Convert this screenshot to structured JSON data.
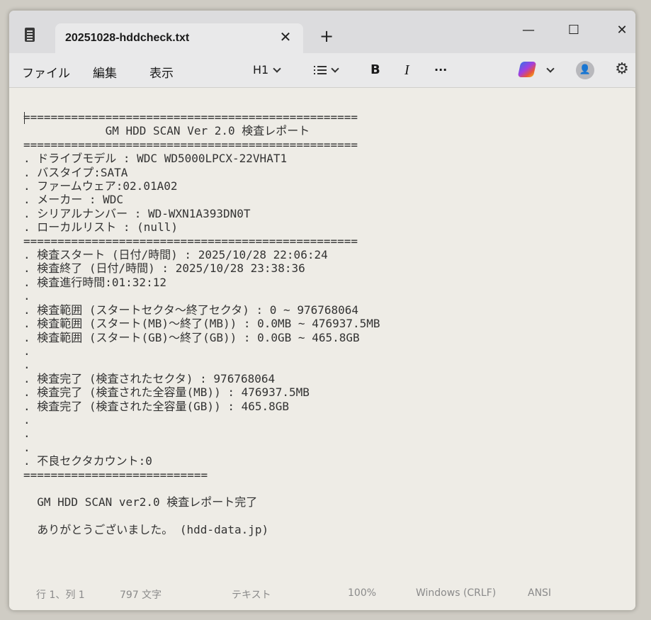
{
  "tab": {
    "title": "20251028-hddcheck.txt"
  },
  "window_controls": {
    "minimize": "—",
    "maximize": "☐",
    "close": "✕"
  },
  "tab_controls": {
    "close": "✕",
    "new_tab": "+"
  },
  "menu": [
    "ファイル",
    "編集",
    "表示"
  ],
  "toolbar": {
    "heading": "H1",
    "bold": "B",
    "italic": "I",
    "more": "···"
  },
  "document": {
    "lines": [
      "=================================================",
      "            GM HDD SCAN Ver 2.0 検査レポート",
      "=================================================",
      ". ドライブモデル : WDC WD5000LPCX-22VHAT1",
      ". バスタイプ:SATA",
      ". ファームウェア:02.01A02",
      ". メーカー : WDC",
      ". シリアルナンバー : WD-WXN1A393DN0T",
      ". ローカルリスト : (null)",
      "=================================================",
      ". 検査スタート (日付/時間) : 2025/10/28 22:06:24",
      ". 検査終了 (日付/時間) : 2025/10/28 23:38:36",
      ". 検査進行時間:01:32:12",
      ".",
      ". 検査範囲 (スタートセクタ～終了セクタ) : 0 ~ 976768064",
      ". 検査範囲 (スタート(MB)～終了(MB)) : 0.0MB ~ 476937.5MB",
      ". 検査範囲 (スタート(GB)～終了(GB)) : 0.0GB ~ 465.8GB",
      ".",
      ".",
      ". 検査完了 (検査されたセクタ) : 976768064",
      ". 検査完了 (検査された全容量(MB)) : 476937.5MB",
      ". 検査完了 (検査された全容量(GB)) : 465.8GB",
      ".",
      ".",
      ".",
      ". 不良セクタカウント:0",
      "===========================",
      "",
      "  GM HDD SCAN ver2.0 検査レポート完了",
      "",
      "  ありがとうございました。 (hdd-data.jp)"
    ]
  },
  "statusbar": {
    "position": "行 1、列 1",
    "chars": "797 文字",
    "format": "テキスト",
    "zoom": "100%",
    "line_ending": "Windows (CRLF)",
    "encoding": "ANSI"
  },
  "icons": {
    "app": "notepad-icon",
    "copilot": "copilot-icon",
    "account": "account-icon",
    "settings": "gear-icon"
  }
}
